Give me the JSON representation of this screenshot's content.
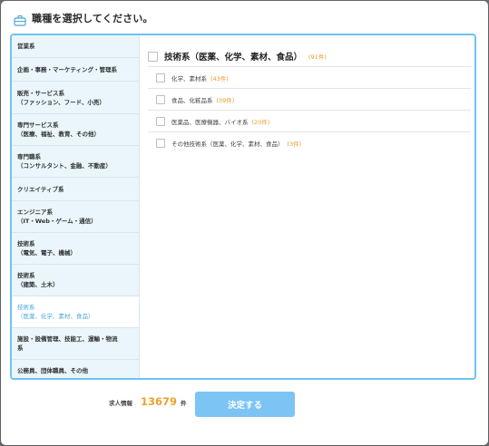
{
  "header": {
    "title": "職種を選択してください。",
    "icon": "bag-icon"
  },
  "sidebar": {
    "items": [
      {
        "label": "営業系",
        "active": false
      },
      {
        "label": "企画・事務・マーケティング・管理系",
        "active": false
      },
      {
        "label": "販売・サービス系\n（ファッション、フード、小売）",
        "active": false
      },
      {
        "label": "専門サービス系\n（医療、福祉、教育、その他）",
        "active": false
      },
      {
        "label": "専門職系\n（コンサルタント、金融、不動産）",
        "active": false
      },
      {
        "label": "クリエイティブ系",
        "active": false
      },
      {
        "label": "エンジニア系\n（IT・Web・ゲーム・通信）",
        "active": false
      },
      {
        "label": "技術系\n（電気、電子、機械）",
        "active": false
      },
      {
        "label": "技術系\n（建築、土木）",
        "active": false
      },
      {
        "label": "技術系\n（医薬、化学、素材、食品）",
        "active": true
      },
      {
        "label": "施設・設備管理、技能工、運輸・物流\n系",
        "active": false
      },
      {
        "label": "公務員、団体職員、その他",
        "active": false
      }
    ]
  },
  "main": {
    "category_label": "技術系（医薬、化学、素材、食品）",
    "category_count": "(91件)",
    "subs": [
      {
        "label": "化学、素材系",
        "count": "(43件)"
      },
      {
        "label": "食品、化粧品系",
        "count": "(39件)"
      },
      {
        "label": "医薬品、医療機器、バイオ系",
        "count": "(20件)"
      },
      {
        "label": "その他技術系（医薬、化学、素材、食品）",
        "count": "(3件)"
      }
    ]
  },
  "footer": {
    "jobs_label": "求人情報",
    "jobs_count": "13679",
    "jobs_unit": "件",
    "submit_label": "決定する"
  },
  "colors": {
    "accent": "#6cc4ef",
    "sidebar_bg": "#eaf6fb",
    "count": "#e59b2c",
    "button": "#7cc4f4"
  }
}
